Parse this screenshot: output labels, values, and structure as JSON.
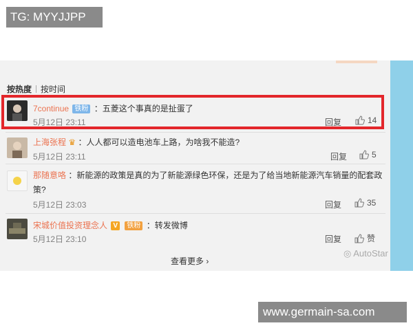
{
  "overlay": {
    "tag": "TG: MYYJJPP",
    "url": "www.germain-sa.com"
  },
  "sort": {
    "by_hot": "按热度",
    "by_time": "按时间"
  },
  "reply_label": "回复",
  "comments": [
    {
      "user": "7continue",
      "badge": "铁粉",
      "text": "：五菱这个事真的是扯蛋了",
      "time": "5月12日 23:11",
      "likes": "14"
    },
    {
      "user": "上海张程",
      "badge": "",
      "text": "：人人都可以造电池车上路，为啥我不能造?",
      "time": "5月12日 23:11",
      "likes": "5"
    },
    {
      "user": "那随意咯",
      "text": "：新能源的政策是真的为了新能源绿色环保，还是为了给当地新能源汽车销量的配套政",
      "text2": "策?",
      "time": "5月12日 23:03",
      "likes": "35"
    },
    {
      "user": "宋城价值投资理念人",
      "badge_v": "V",
      "badge": "铁粉",
      "text": "：转发微博",
      "time": "5月12日 23:10",
      "likes": "赞"
    }
  ],
  "more_label": "查看更多 ›",
  "watermark": "AutoStar",
  "colors": {
    "highlight": "#e3262b",
    "username": "#eb7350",
    "side_bar": "#8fd0e9"
  }
}
